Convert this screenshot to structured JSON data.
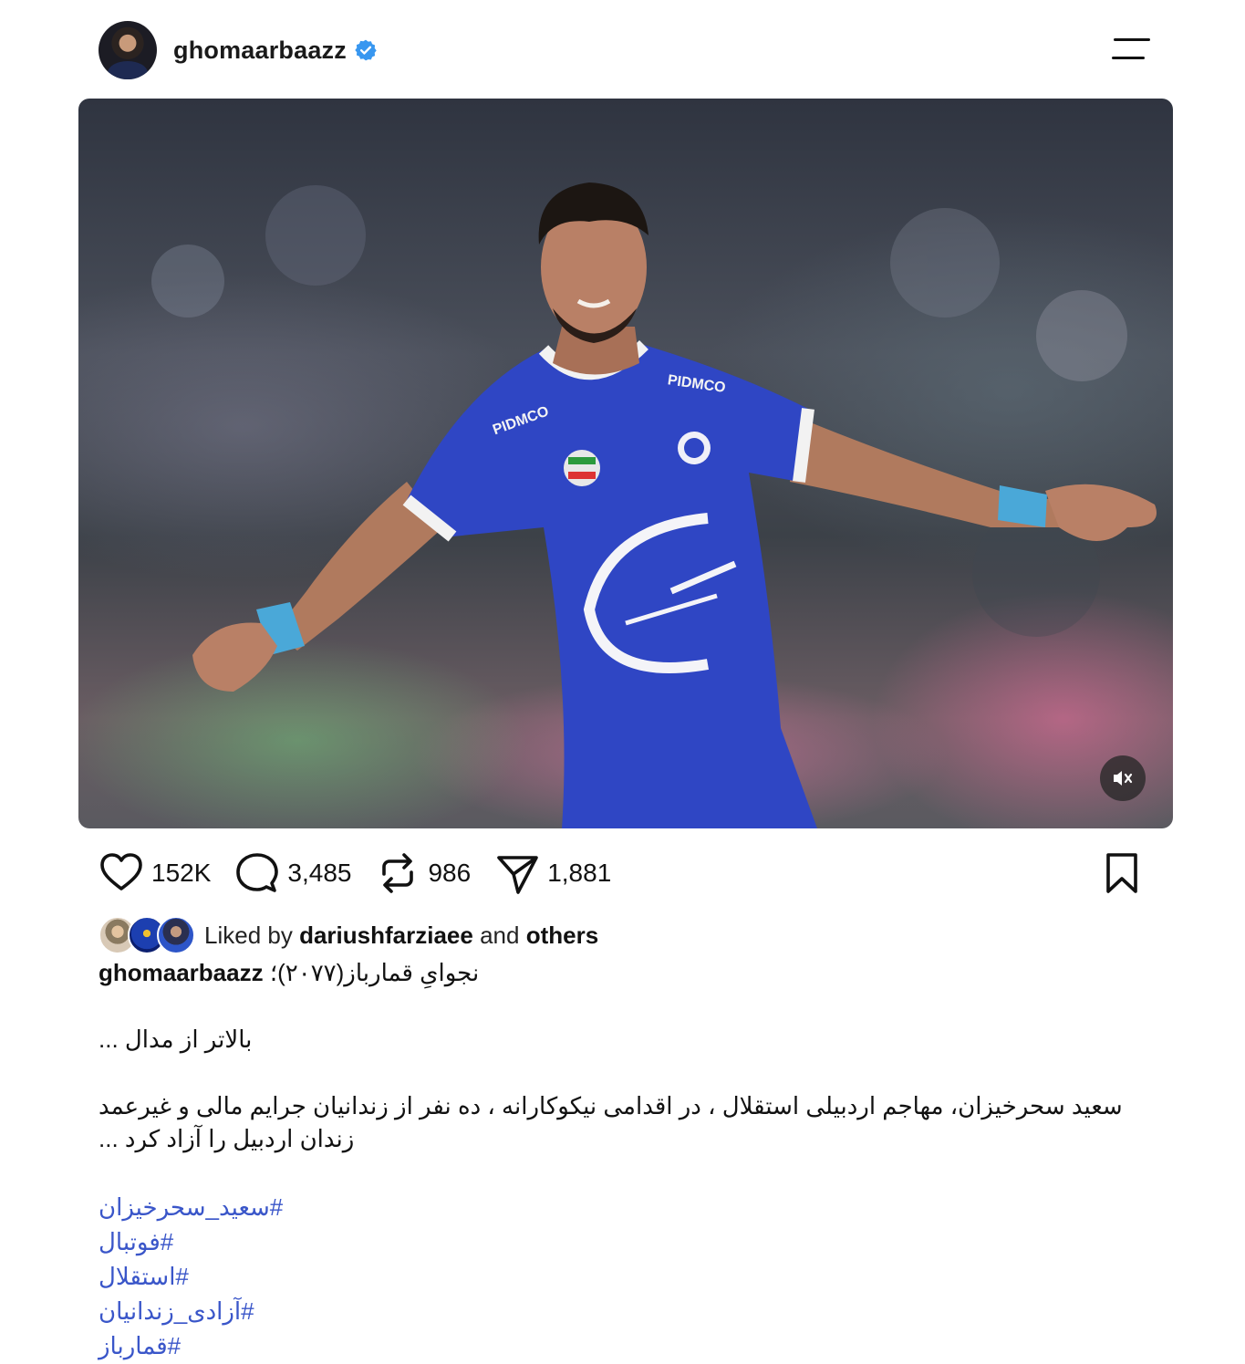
{
  "post": {
    "username": "ghomaarbaazz",
    "verified_icon": "verified-badge-icon",
    "menu_icon": "menu-icon"
  },
  "media": {
    "jersey_sponsor_top": "PIDMCO",
    "mute_icon": "speaker-muted-icon"
  },
  "actions": {
    "likes": "152K",
    "comments": "3,485",
    "reposts": "986",
    "shares": "1,881"
  },
  "liked_by": {
    "prefix": "Liked by",
    "user": "dariushfarziaee",
    "and": "and",
    "others": "others"
  },
  "caption": {
    "user": "ghomaarbaazz",
    "title": "نجوایِ قمارباز(۲۰۷۷)؛",
    "line1": "بالاتر از مدال ...",
    "line2": "سعید سحرخیزان، مهاجم اردبیلی استقلال ، در اقدامی نیکوکارانه ، ده نفر از زندانیان جرایم مالی و غیرعمد",
    "line3": "زندان اردبیل را آزاد کرد ...",
    "hashtags": [
      "#سعید_سحرخیزان",
      "#فوتبال",
      "#استقلال",
      "#آزادی_زندانیان",
      "#قمارباز"
    ]
  },
  "colors": {
    "hashtag": "#3a56c9",
    "verified": "#3897f0",
    "jersey": "#2f46c4"
  }
}
